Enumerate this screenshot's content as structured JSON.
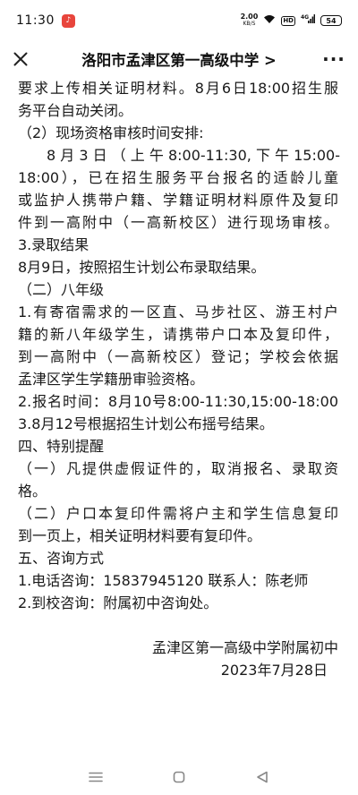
{
  "status_bar": {
    "time": "11:30",
    "net_speed_value": "2.00",
    "net_speed_unit": "KB/S",
    "hd_label": "HD",
    "signal_label": "4G",
    "battery": "54"
  },
  "header": {
    "title": "洛阳市孟津区第一高级中学",
    "title_arrow": ">",
    "more_label": "···"
  },
  "article": {
    "lines": [
      "要求上传相关证明材料。8月6日18:00招生服",
      "务平台自动关闭。",
      "（2）现场资格审核时间安排:",
      "　　8 月 3 日 （ 上 午 8:00-11:30, 下 午 15:00-",
      "18:00），已在招生服务平台报名的适龄儿童",
      "或监护人携带户籍、学籍证明材料原件及复印",
      "件到一高附中（一高新校区）进行现场审核。",
      "3.录取结果",
      "8月9日，按照招生计划公布录取结果。",
      "（二）八年级",
      "1.有寄宿需求的一区直、马步社区、游王村户",
      "籍的新八年级学生，请携带户口本及复印件，",
      "到一高附中（一高新校区）登记；学校会依据",
      "孟津区学生学籍册审验资格。",
      "2.报名时间：8月10号8:00-11:30,15:00-18:00",
      "3.8月12号根据招生计划公布摇号结果。",
      "四、特别提醒",
      "（一）凡提供虚假证件的，取消报名、录取资",
      "格。",
      "（二）户口本复印件需将户主和学生信息复印",
      "到一页上，相关证明材料要有复印件。",
      "五、咨询方式",
      "1.电话咨询：15837945120 联系人：陈老师",
      "2.到校咨询：附属初中咨询处。",
      "",
      "孟津区第一高级中学附属初中",
      "2023年7月28日"
    ]
  },
  "nav_bar": {
    "menu_icon": "menu-icon",
    "home_icon": "home-icon",
    "back_icon": "back-icon"
  }
}
